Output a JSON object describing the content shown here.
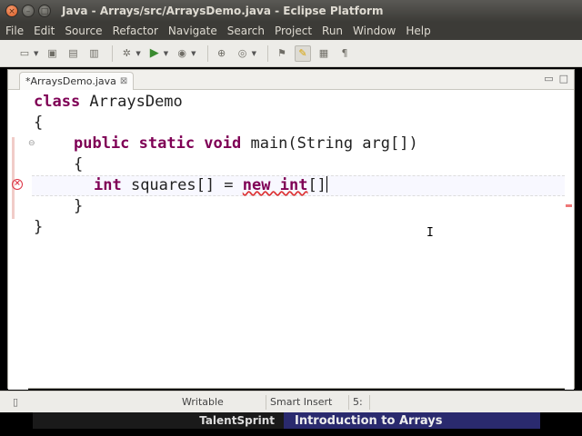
{
  "window": {
    "title": "Java - Arrays/src/ArraysDemo.java - Eclipse Platform",
    "buttons": [
      "×",
      "–",
      "□"
    ]
  },
  "menu": [
    "File",
    "Edit",
    "Source",
    "Refactor",
    "Navigate",
    "Search",
    "Project",
    "Run",
    "Window",
    "Help"
  ],
  "toolbar": {
    "icons": [
      "new-icon",
      "save-icon",
      "save-all-icon",
      "print-icon",
      "debug-icon",
      "run-icon",
      "external-tools-icon",
      "open-type-icon",
      "search-icon",
      "mark-occurrences-icon",
      "show-whitespace-icon"
    ]
  },
  "editor": {
    "tab_label": "*ArraysDemo.java",
    "tab_close": "⊠",
    "code_lines": [
      {
        "kw": "class",
        "text": " ArraysDemo"
      },
      {
        "kw": "",
        "text": "{"
      },
      {
        "kw": "public static void",
        "text": " main(String arg[])"
      },
      {
        "kw": "",
        "text": "{"
      },
      {
        "kw": "int",
        "text": " squares[] = "
      },
      {
        "kw": "",
        "text": "}"
      },
      {
        "kw": "",
        "text": "}"
      }
    ],
    "line5_kw2": "new int",
    "line5_tail": "[]"
  },
  "status": {
    "writable": "Writable",
    "insert_mode": "Smart Insert",
    "position": "5:"
  },
  "banner": {
    "left": "TalentSprint",
    "right": "Introduction to Arrays"
  }
}
